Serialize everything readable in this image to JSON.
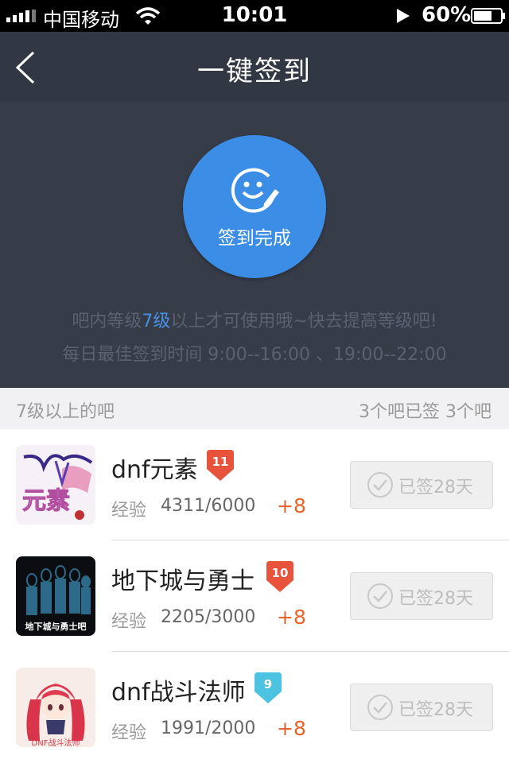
{
  "status_bar": {
    "carrier": "中国移动",
    "time": "10:01",
    "battery": "60%"
  },
  "nav": {
    "title": "一键签到"
  },
  "hero": {
    "status_label": "签到完成",
    "hint_before": "吧内等级",
    "hint_level": "7级",
    "hint_after": "以上才可使用哦~快去提高等级吧!",
    "best_time": "每日最佳签到时间  9:00--16:00 、19:00--22:00",
    "accent_color": "#3b8de5"
  },
  "section": {
    "title": "7级以上的吧",
    "summary": "3个吧已签  3个吧"
  },
  "forums": [
    {
      "name": "dnf元素",
      "level": "11",
      "badge_color": "#e8533b",
      "exp_label": "经验",
      "exp": "4311/6000",
      "gain": "+8",
      "button_label": "已签28天"
    },
    {
      "name": "地下城与勇士",
      "level": "10",
      "badge_color": "#e8533b",
      "exp_label": "经验",
      "exp": "2205/3000",
      "gain": "+8",
      "button_label": "已签28天"
    },
    {
      "name": "dnf战斗法师",
      "level": "9",
      "badge_color": "#4cc3e0",
      "exp_label": "经验",
      "exp": "1991/2000",
      "gain": "+8",
      "button_label": "已签28天"
    }
  ],
  "avatar_texts": {
    "a1": "元素",
    "a2": "地下城与勇士吧",
    "a3": "DNF战斗法师"
  }
}
